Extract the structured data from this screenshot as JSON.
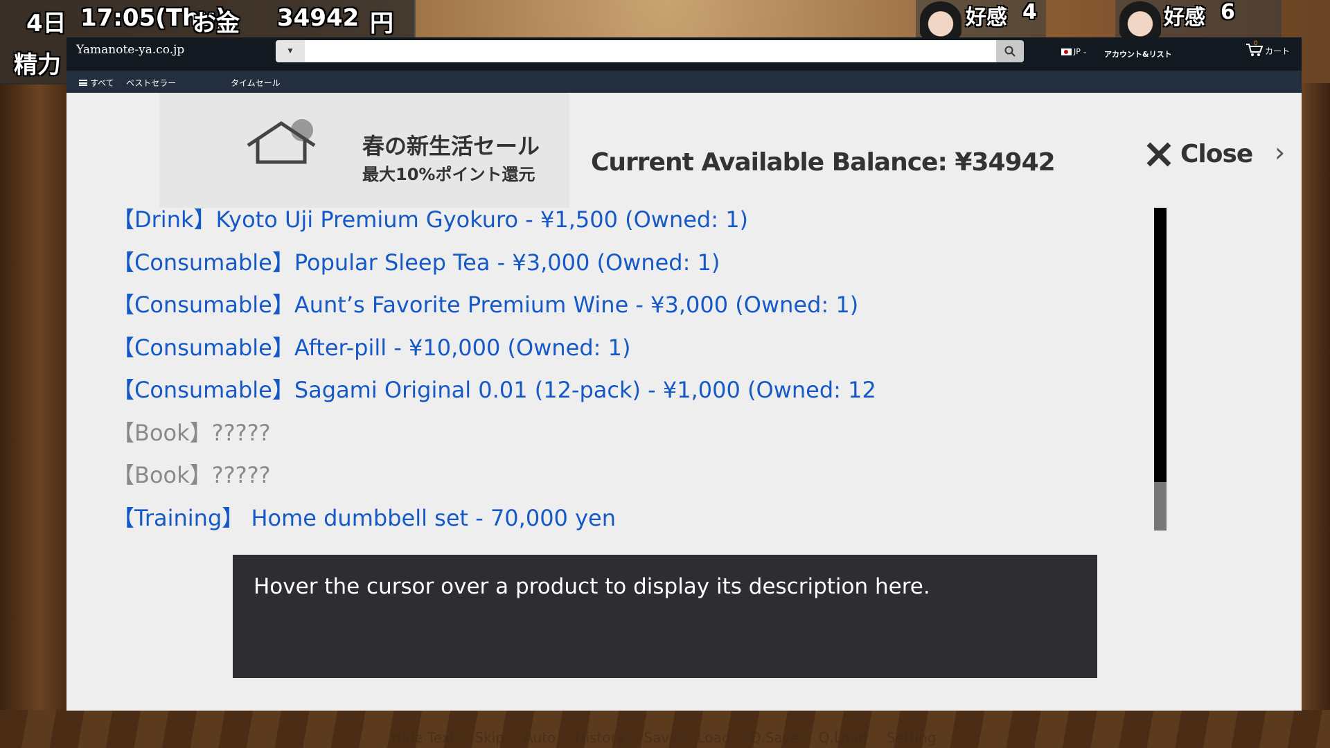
{
  "hud": {
    "day": "4日",
    "time": "17:05(Thu)",
    "money_label": "お金",
    "money": "34942",
    "currency": "円",
    "stamina_label": "精力"
  },
  "characters": [
    {
      "affection_label": "好感",
      "affection": "4"
    },
    {
      "affection_label": "好感",
      "affection": "6"
    }
  ],
  "game_menu": [
    "Hide Text",
    "Skip",
    "Auto",
    "History",
    "Save",
    "Load",
    "Q.Save",
    "Q.Load",
    "Setting"
  ],
  "shop": {
    "logo": "Yamanote-ya.co.jp",
    "search": {
      "value": "",
      "placeholder": ""
    },
    "language": "JP",
    "account": "アカウント&リスト",
    "cart": {
      "label": "カート",
      "count": "0"
    },
    "nav": {
      "all": "すべて",
      "bestseller": "ベストセラー",
      "timesale": "タイムセール"
    },
    "banner": {
      "title": "春の新生活セール",
      "subtitle": "最大10%ポイント還元"
    },
    "balance": "Current Available Balance: ¥34942",
    "close_label": "Close",
    "products": [
      {
        "text": "【Drink】Kyoto Uji Premium Gyokuro - ¥1,500  (Owned: 1)",
        "locked": false
      },
      {
        "text": "【Consumable】Popular Sleep Tea - ¥3,000  (Owned: 1)",
        "locked": false
      },
      {
        "text": "【Consumable】Aunt’s Favorite Premium Wine - ¥3,000  (Owned: 1)",
        "locked": false
      },
      {
        "text": "【Consumable】After-pill - ¥10,000  (Owned: 1)",
        "locked": false
      },
      {
        "text": "【Consumable】Sagami Original 0.01 (12-pack) - ¥1,000  (Owned: 12)",
        "locked": false
      },
      {
        "text": "【Book】?????",
        "locked": true
      },
      {
        "text": "【Book】?????",
        "locked": true
      },
      {
        "text": "【Training】 Home dumbbell set - 70,000 yen",
        "locked": false
      }
    ],
    "description": "Hover the cursor over a product to display its description here."
  },
  "colors": {
    "link": "#1559c9",
    "locked": "#8a8a8a",
    "topbar": "#131921",
    "subnav": "#232f3e",
    "desc_bg": "#2e2d31"
  }
}
